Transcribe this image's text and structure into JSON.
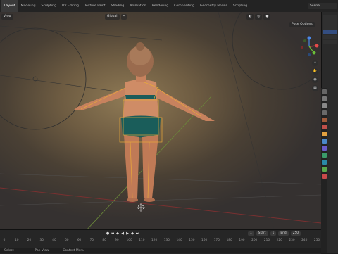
{
  "app": {
    "workspace_tabs": [
      "Layout",
      "Modeling",
      "Sculpting",
      "UV Editing",
      "Texture Paint",
      "Shading",
      "Animation",
      "Rendering",
      "Compositing",
      "Geometry Nodes",
      "Scripting"
    ],
    "active_tab_index": 0,
    "scene_label": "Scene"
  },
  "viewport": {
    "orientation_label": "Global",
    "pose_options_label": "Pose Options",
    "view_label": "View"
  },
  "gizmo": {
    "x_color": "#e84a4a",
    "y_color": "#6bbf3a",
    "z_color": "#4a88e8"
  },
  "timeline": {
    "ticks": [
      "0",
      "10",
      "20",
      "30",
      "40",
      "50",
      "60",
      "70",
      "80",
      "90",
      "100",
      "110",
      "120",
      "130",
      "140",
      "150",
      "160",
      "170",
      "180",
      "190",
      "200",
      "210",
      "220",
      "230",
      "240",
      "250"
    ],
    "current_frame": "1",
    "start_label": "Start",
    "start_value": "1",
    "end_label": "End",
    "end_value": "250"
  },
  "statusbar": {
    "item1": "Select",
    "item2": "Pan View",
    "item3": "Context Menu"
  },
  "colors": {
    "accent": "#4a7ad0",
    "bone_outline": "#e8a93a"
  }
}
